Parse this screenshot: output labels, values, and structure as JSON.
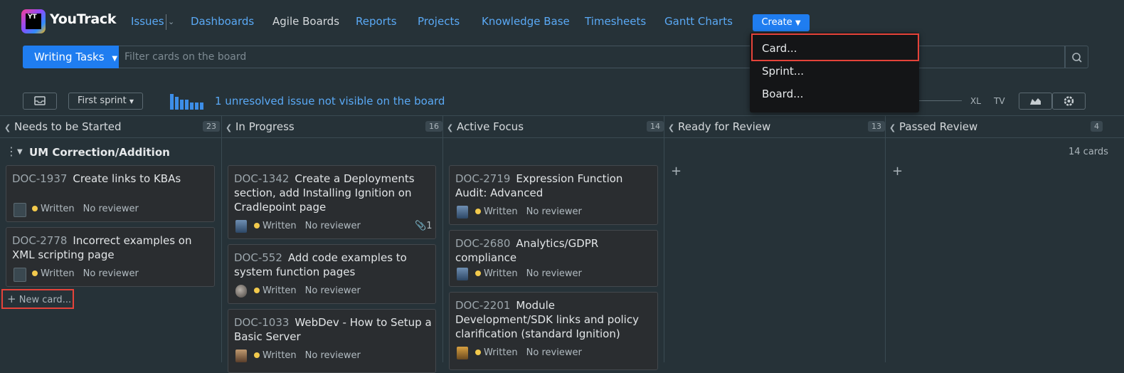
{
  "app": {
    "name": "YouTrack",
    "logo_text": "YT"
  },
  "nav": {
    "issues": "Issues",
    "dashboards": "Dashboards",
    "agile_boards": "Agile Boards",
    "reports": "Reports",
    "projects": "Projects",
    "knowledge_base": "Knowledge Base",
    "timesheets": "Timesheets",
    "gantt_charts": "Gantt Charts",
    "create": "Create"
  },
  "create_menu": {
    "items": [
      "Card...",
      "Sprint...",
      "Board..."
    ]
  },
  "board": {
    "name": "Writing Tasks",
    "filter_placeholder": "Filter cards on the board",
    "sprint": "First sprint",
    "unresolved_notice": "1 unresolved issue not visible on the board",
    "size_labels": [
      "XL",
      "TV"
    ]
  },
  "columns": [
    {
      "title": "Needs to be Started",
      "count": "23"
    },
    {
      "title": "In Progress",
      "count": "16"
    },
    {
      "title": "Active Focus",
      "count": "14"
    },
    {
      "title": "Ready for Review",
      "count": "13"
    },
    {
      "title": "Passed Review",
      "count": "4"
    }
  ],
  "swimlane": {
    "title": "UM Correction/Addition",
    "count": "14 cards"
  },
  "cards": {
    "c1937": {
      "id": "DOC-1937",
      "title": "Create links to KBAs",
      "status": "Written",
      "reviewer": "No reviewer"
    },
    "c2778": {
      "id": "DOC-2778",
      "title": "Incorrect examples on XML scripting page",
      "status": "Written",
      "reviewer": "No reviewer"
    },
    "c1342": {
      "id": "DOC-1342",
      "title": "Create a Deployments section, add Installing Ignition on Cradlepoint page",
      "status": "Written",
      "reviewer": "No reviewer",
      "attachments": "1"
    },
    "c552": {
      "id": "DOC-552",
      "title": "Add code examples to system function pages",
      "status": "Written",
      "reviewer": "No reviewer"
    },
    "c1033": {
      "id": "DOC-1033",
      "title": "WebDev - How to Setup a Basic Server",
      "status": "Written",
      "reviewer": "No reviewer"
    },
    "c2719": {
      "id": "DOC-2719",
      "title": "Expression Function Audit: Advanced",
      "status": "Written",
      "reviewer": "No reviewer"
    },
    "c2680": {
      "id": "DOC-2680",
      "title": "Analytics/GDPR compliance",
      "status": "Written",
      "reviewer": "No reviewer"
    },
    "c2201": {
      "id": "DOC-2201",
      "title": "Module Development/SDK links and policy clarification (standard Ignition)",
      "status": "Written",
      "reviewer": "No reviewer"
    }
  },
  "new_card_label": "New card...",
  "colors": {
    "accent": "#1f7df0",
    "link": "#5aa9f5",
    "background": "#263238",
    "card": "#2a2d30",
    "status_written": "#f2c94c",
    "highlight": "#e5433a"
  }
}
